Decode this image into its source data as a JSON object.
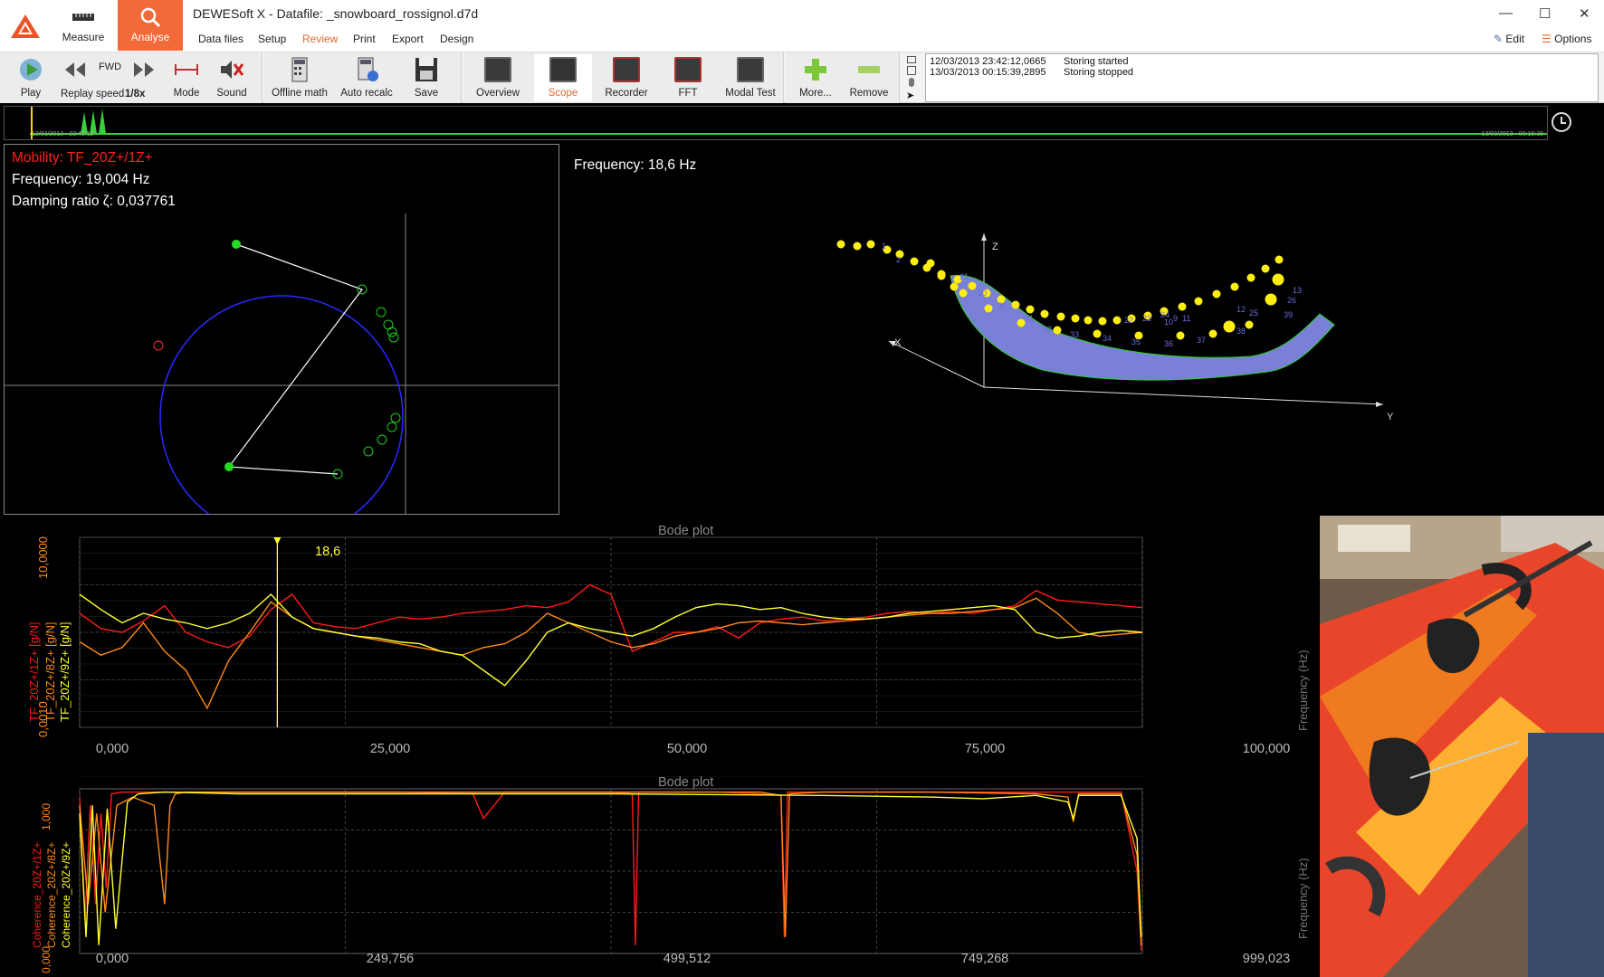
{
  "app": {
    "title": "DEWESoft X - Datafile: _snowboard_rossignol.d7d",
    "measure_label": "Measure",
    "analyse_label": "Analyse",
    "menus": [
      "Data files",
      "Setup",
      "Review",
      "Print",
      "Export",
      "Design"
    ],
    "active_menu": "Review",
    "edit_label": "Edit",
    "options_label": "Options"
  },
  "toolbar": {
    "play": "Play",
    "fwd": "FWD",
    "replay_speed": "Replay speed",
    "speed_value": "1/8x",
    "mode": "Mode",
    "sound": "Sound",
    "offline_math": "Offline math",
    "auto_recalc": "Auto recalc",
    "save": "Save",
    "overview": "Overview",
    "scope": "Scope",
    "recorder": "Recorder",
    "fft": "FFT",
    "modal_test": "Modal Test",
    "more": "More...",
    "remove": "Remove"
  },
  "log": [
    {
      "time": "12/03/2013 23:42:12,0665",
      "event": "Storing started"
    },
    {
      "time": "13/03/2013 00:15:39,2895",
      "event": "Storing stopped"
    }
  ],
  "timeline": {
    "start": "12/03/2013 - 23:42:12",
    "end": "13/03/2013 - 00:15:39"
  },
  "nyquist": {
    "mobility": "Mobility: TF_20Z+/1Z+",
    "frequency": "Frequency: 19,004 Hz",
    "damping": "Damping ratio ζ: 0,037761"
  },
  "mode_shape": {
    "frequency": "Frequency: 18,6 Hz",
    "axis_x": "X",
    "axis_y": "Y",
    "axis_z": "Z",
    "node_labels": [
      "1",
      "2",
      "13",
      "26",
      "39",
      "10",
      "11",
      "12",
      "25",
      "38",
      "37",
      "36",
      "35",
      "34",
      "33",
      "32",
      "31",
      "30",
      "20",
      "21",
      "22",
      "23",
      "24",
      "9"
    ]
  },
  "chart_data": [
    {
      "type": "line",
      "title": "Bode plot",
      "cursor": "18,6",
      "x_ticks": [
        "0,000",
        "25,000",
        "50,000",
        "75,000",
        "100,000"
      ],
      "xlim": [
        0,
        100
      ],
      "ylabel_right": "Frequency (Hz)",
      "y_titles": [
        "TF_20Z+/9Z+ [g/N]",
        "TF_20Z+/8Z+ [g/N]",
        "TF_20Z+/1Z+ [g/N]"
      ],
      "y_ticks_left": [
        "0,0010",
        "10,0000"
      ],
      "series": [
        {
          "name": "TF_20Z+/1Z+",
          "color": "#ff1a1a",
          "x": [
            0,
            2,
            4,
            6,
            8,
            10,
            12,
            14,
            16,
            18,
            20,
            22,
            24,
            26,
            28,
            30,
            32,
            34,
            36,
            38,
            40,
            42,
            44,
            46,
            48,
            50,
            52,
            54,
            56,
            58,
            60,
            62,
            64,
            66,
            68,
            70,
            72,
            74,
            76,
            78,
            80,
            82,
            84,
            86,
            88,
            90,
            92,
            94,
            96,
            98,
            100
          ],
          "y": [
            0.6,
            0.52,
            0.5,
            0.56,
            0.64,
            0.5,
            0.45,
            0.42,
            0.48,
            0.62,
            0.7,
            0.55,
            0.53,
            0.52,
            0.55,
            0.58,
            0.57,
            0.58,
            0.6,
            0.61,
            0.62,
            0.64,
            0.63,
            0.66,
            0.75,
            0.7,
            0.4,
            0.45,
            0.5,
            0.5,
            0.53,
            0.47,
            0.55,
            0.57,
            0.58,
            0.56,
            0.57,
            0.58,
            0.6,
            0.61,
            0.6,
            0.61,
            0.6,
            0.62,
            0.64,
            0.72,
            0.67,
            0.66,
            0.65,
            0.64,
            0.63
          ]
        },
        {
          "name": "TF_20Z+/8Z+",
          "color": "#ff8a1a",
          "x": [
            0,
            2,
            4,
            6,
            8,
            10,
            12,
            14,
            16,
            18,
            20,
            22,
            24,
            26,
            28,
            30,
            32,
            34,
            36,
            38,
            40,
            42,
            44,
            46,
            48,
            50,
            52,
            54,
            56,
            58,
            60,
            62,
            64,
            66,
            68,
            70,
            72,
            74,
            76,
            78,
            80,
            82,
            84,
            86,
            88,
            90,
            92,
            94,
            96,
            98,
            100
          ],
          "y": [
            0.45,
            0.38,
            0.42,
            0.55,
            0.4,
            0.3,
            0.1,
            0.35,
            0.5,
            0.66,
            0.58,
            0.52,
            0.5,
            0.48,
            0.46,
            0.44,
            0.42,
            0.4,
            0.38,
            0.42,
            0.44,
            0.5,
            0.6,
            0.55,
            0.5,
            0.45,
            0.42,
            0.44,
            0.48,
            0.5,
            0.52,
            0.55,
            0.56,
            0.55,
            0.54,
            0.55,
            0.56,
            0.57,
            0.58,
            0.59,
            0.6,
            0.6,
            0.61,
            0.62,
            0.63,
            0.68,
            0.6,
            0.5,
            0.48,
            0.49,
            0.5
          ]
        },
        {
          "name": "TF_20Z+/9Z+",
          "color": "#ffff30",
          "x": [
            0,
            2,
            4,
            6,
            8,
            10,
            12,
            14,
            16,
            18,
            20,
            22,
            24,
            26,
            28,
            30,
            32,
            34,
            36,
            38,
            40,
            42,
            44,
            46,
            48,
            50,
            52,
            54,
            56,
            58,
            60,
            62,
            64,
            66,
            68,
            70,
            72,
            74,
            76,
            78,
            80,
            82,
            84,
            86,
            88,
            90,
            92,
            94,
            96,
            98,
            100
          ],
          "y": [
            0.7,
            0.62,
            0.55,
            0.6,
            0.57,
            0.55,
            0.52,
            0.55,
            0.6,
            0.7,
            0.58,
            0.52,
            0.5,
            0.48,
            0.47,
            0.45,
            0.44,
            0.4,
            0.38,
            0.3,
            0.22,
            0.35,
            0.5,
            0.55,
            0.52,
            0.5,
            0.48,
            0.52,
            0.58,
            0.63,
            0.65,
            0.64,
            0.62,
            0.63,
            0.6,
            0.58,
            0.57,
            0.57,
            0.58,
            0.6,
            0.61,
            0.62,
            0.63,
            0.64,
            0.62,
            0.5,
            0.47,
            0.48,
            0.5,
            0.51,
            0.5
          ]
        }
      ]
    },
    {
      "type": "line",
      "title": "Bode plot",
      "x_ticks": [
        "0,000",
        "249,756",
        "499,512",
        "749,268",
        "999,023"
      ],
      "xlim": [
        0,
        1000
      ],
      "ylabel_right": "Frequency (Hz)",
      "y_titles": [
        "Coherence_20Z+/1Z+",
        "Coherence_20Z+/8Z+",
        "Coherence_20Z+/9Z+"
      ],
      "y_ticks_left": [
        "0,000",
        "1,000"
      ],
      "series": [
        {
          "name": "Coherence_20Z+/1Z+",
          "color": "#ff1a1a",
          "x": [
            0,
            5,
            10,
            15,
            20,
            25,
            30,
            40,
            60,
            100,
            200,
            300,
            370,
            380,
            400,
            450,
            500,
            520,
            523,
            526,
            560,
            600,
            640,
            660,
            663,
            666,
            700,
            800,
            900,
            950,
            980,
            995,
            999
          ],
          "y": [
            0.95,
            0.2,
            0.9,
            0.3,
            0.85,
            0.4,
            0.97,
            0.98,
            0.98,
            0.98,
            0.98,
            0.98,
            0.97,
            0.82,
            0.98,
            0.98,
            0.98,
            0.97,
            0.05,
            0.98,
            0.98,
            0.98,
            0.97,
            0.96,
            0.1,
            0.98,
            0.98,
            0.98,
            0.98,
            0.98,
            0.98,
            0.5,
            0.02
          ]
        },
        {
          "name": "Coherence_20Z+/8Z+",
          "color": "#ff8a1a",
          "x": [
            0,
            8,
            16,
            24,
            35,
            50,
            70,
            80,
            85,
            90,
            100,
            150,
            300,
            500,
            640,
            660,
            664,
            668,
            700,
            800,
            900,
            930,
            935,
            940,
            980,
            995,
            999
          ],
          "y": [
            0.9,
            0.3,
            0.85,
            0.25,
            0.9,
            0.95,
            0.9,
            0.3,
            0.9,
            0.97,
            0.98,
            0.98,
            0.98,
            0.98,
            0.98,
            0.96,
            0.1,
            0.97,
            0.98,
            0.98,
            0.97,
            0.95,
            0.8,
            0.97,
            0.97,
            0.6,
            0.05
          ]
        },
        {
          "name": "Coherence_20Z+/9Z+",
          "color": "#ffff30",
          "x": [
            0,
            6,
            12,
            18,
            26,
            34,
            45,
            55,
            80,
            150,
            300,
            500,
            700,
            800,
            850,
            900,
            930,
            935,
            940,
            980,
            995,
            999
          ],
          "y": [
            0.85,
            0.1,
            0.9,
            0.05,
            0.88,
            0.15,
            0.92,
            0.97,
            0.98,
            0.97,
            0.97,
            0.97,
            0.96,
            0.95,
            0.94,
            0.96,
            0.92,
            0.82,
            0.96,
            0.96,
            0.7,
            0.1
          ]
        }
      ]
    }
  ]
}
